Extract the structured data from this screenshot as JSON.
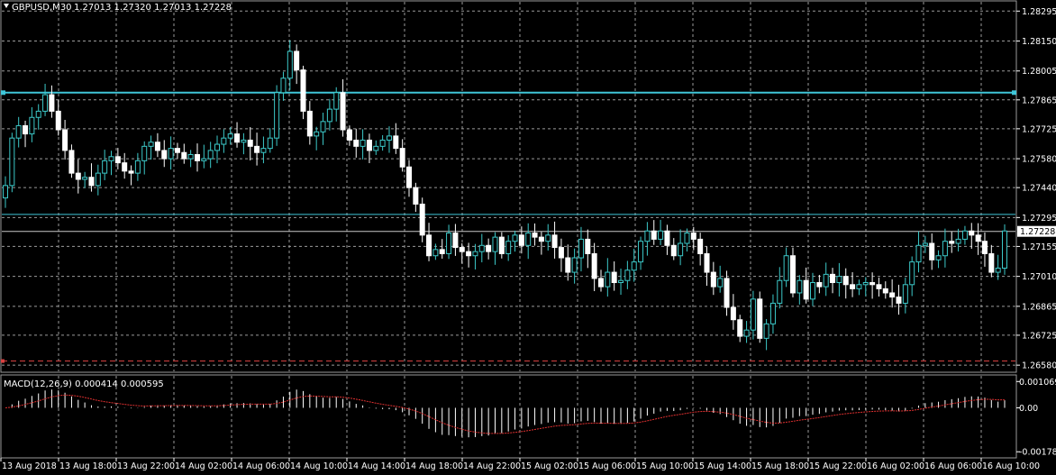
{
  "header": {
    "symbol_label": "GBPUSD,M30",
    "ohlc_label": "1.27013 1.27320 1.27013 1.27228"
  },
  "macd": {
    "label": "MACD(12,26,9) 0.000414 0.000595",
    "tick_labels": [
      "0.001069",
      "0.00",
      "-0.001788"
    ]
  },
  "price_axis": {
    "tick_labels": [
      "1.28295",
      "1.28150",
      "1.28005",
      "1.27865",
      "1.27725",
      "1.27580",
      "1.27440",
      "1.27295",
      "1.27155",
      "1.27010",
      "1.26865",
      "1.26725",
      "1.26580"
    ],
    "current_price_label": "1.27228"
  },
  "time_axis": {
    "tick_labels": [
      "13 Aug 2018",
      "13 Aug 18:00",
      "13 Aug 22:00",
      "14 Aug 02:00",
      "14 Aug 06:00",
      "14 Aug 10:00",
      "14 Aug 14:00",
      "14 Aug 18:00",
      "14 Aug 22:00",
      "15 Aug 02:00",
      "15 Aug 06:00",
      "15 Aug 10:00",
      "15 Aug 14:00",
      "15 Aug 18:00",
      "15 Aug 22:00",
      "16 Aug 02:00",
      "16 Aug 06:00",
      "16 Aug 10:00"
    ]
  },
  "colors": {
    "background": "#000000",
    "grid": "#9a9a9a",
    "bull_body": "#000000",
    "bull_outline": "#3cc9c9",
    "bear_body": "#ffffff",
    "bear_outline": "#ffffff",
    "resistance_line": "#3fc6d8",
    "support_line": "#d84040",
    "macd_hist": "#ffffff",
    "macd_signal": "#e03030"
  },
  "chart_data": {
    "type": "candlestick",
    "symbol": "GBPUSD",
    "timeframe": "M30",
    "y_range": [
      1.2655,
      1.2834
    ],
    "closes": [
      1.2745,
      1.2768,
      1.2774,
      1.277,
      1.2778,
      1.2781,
      1.2789,
      1.2781,
      1.2772,
      1.2762,
      1.2751,
      1.2748,
      1.2749,
      1.2745,
      1.2751,
      1.2757,
      1.2759,
      1.2756,
      1.2752,
      1.2751,
      1.2757,
      1.2764,
      1.2766,
      1.2762,
      1.2758,
      1.2763,
      1.2761,
      1.2758,
      1.276,
      1.2757,
      1.2758,
      1.2762,
      1.2765,
      1.2768,
      1.277,
      1.2766,
      1.2767,
      1.2764,
      1.2761,
      1.2763,
      1.2768,
      1.279,
      1.2797,
      1.281,
      1.2801,
      1.2781,
      1.2769,
      1.2771,
      1.2776,
      1.2782,
      1.279,
      1.2772,
      1.2767,
      1.2764,
      1.2767,
      1.2762,
      1.2764,
      1.2767,
      1.2769,
      1.2763,
      1.2754,
      1.2744,
      1.2736,
      1.2721,
      1.2711,
      1.2714,
      1.2712,
      1.2722,
      1.2715,
      1.2713,
      1.2711,
      1.2713,
      1.2716,
      1.2713,
      1.272,
      1.2712,
      1.2718,
      1.2721,
      1.2716,
      1.2722,
      1.272,
      1.2718,
      1.2721,
      1.2715,
      1.271,
      1.2703,
      1.271,
      1.2719,
      1.2712,
      1.27,
      1.2696,
      1.2703,
      1.2698,
      1.2699,
      1.2704,
      1.2708,
      1.2718,
      1.2723,
      1.2719,
      1.2723,
      1.2716,
      1.2711,
      1.2717,
      1.2722,
      1.2719,
      1.2712,
      1.2703,
      1.2696,
      1.27,
      1.2686,
      1.268,
      1.2672,
      1.2675,
      1.269,
      1.2671,
      1.2678,
      1.2688,
      1.2699,
      1.2711,
      1.2693,
      1.2699,
      1.269,
      1.2698,
      1.2696,
      1.2702,
      1.2698,
      1.2701,
      1.2697,
      1.2695,
      1.2697,
      1.2698,
      1.2697,
      1.2695,
      1.2693,
      1.2691,
      1.2688,
      1.2697,
      1.2708,
      1.2716,
      1.2717,
      1.2709,
      1.2711,
      1.2718,
      1.2717,
      1.2719,
      1.2723,
      1.2721,
      1.2718,
      1.2712,
      1.2703,
      1.2705,
      1.2723
    ],
    "x_labels": [
      "13 Aug 2018",
      "13 Aug 18:00",
      "13 Aug 22:00",
      "14 Aug 02:00",
      "14 Aug 06:00",
      "14 Aug 10:00",
      "14 Aug 14:00",
      "14 Aug 18:00",
      "14 Aug 22:00",
      "15 Aug 02:00",
      "15 Aug 06:00",
      "15 Aug 10:00",
      "15 Aug 14:00",
      "15 Aug 18:00",
      "15 Aug 22:00",
      "16 Aug 02:00",
      "16 Aug 06:00",
      "16 Aug 10:00"
    ],
    "last_price": 1.27228,
    "horizontal_lines": [
      {
        "kind": "resistance",
        "price": 1.279
      },
      {
        "kind": "level",
        "price": 1.2731
      },
      {
        "kind": "support",
        "price": 1.266
      }
    ],
    "macd": {
      "params": "12,26,9",
      "value": 0.000414,
      "signal": 0.000595,
      "y_range": [
        -0.002,
        0.0013
      ]
    },
    "grid": true
  }
}
